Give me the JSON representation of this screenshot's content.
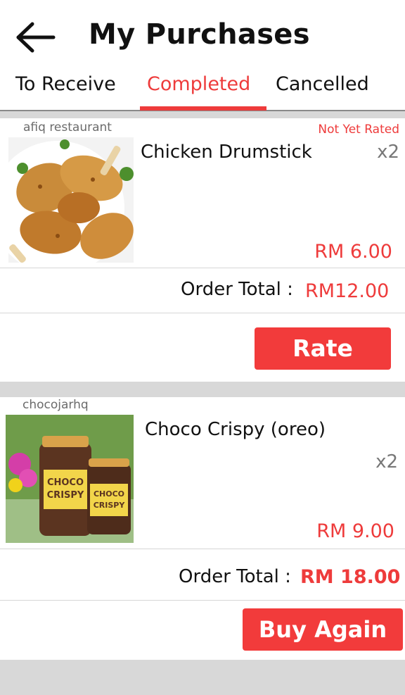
{
  "header": {
    "title": "My Purchases",
    "back_icon": "arrow-left-icon"
  },
  "tabs": [
    {
      "label": "To Receive",
      "active": false
    },
    {
      "label": "Completed",
      "active": true
    },
    {
      "label": "Cancelled",
      "active": false
    }
  ],
  "orders": [
    {
      "shop": "afiq restaurant",
      "status": "Not Yet Rated",
      "item_name": "Chicken Drumstick",
      "quantity": "x2",
      "price": "RM 6.00",
      "total_label": "Order Total :",
      "total_value": "RM12.00",
      "action_label": "Rate"
    },
    {
      "shop": "chocojarhq",
      "item_name": "Choco Crispy (oreo)",
      "quantity": "x2",
      "price": "RM 9.00",
      "total_label": "Order Total :",
      "total_value": "RM 18.00",
      "action_label": "Buy Again",
      "jar_label_1": "CHOCO",
      "jar_label_2": "CRISPY"
    }
  ],
  "colors": {
    "accent": "#ee3b3b",
    "button": "#f23b3b",
    "background_gap": "#d8d8d8"
  }
}
